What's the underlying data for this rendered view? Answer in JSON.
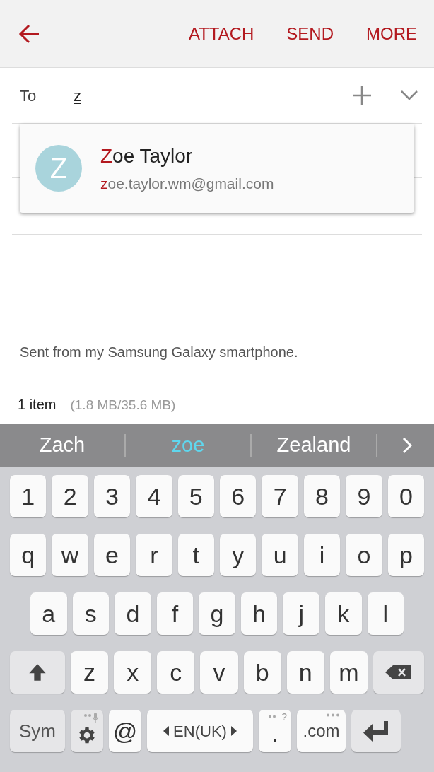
{
  "toolbar": {
    "actions": [
      "ATTACH",
      "SEND",
      "MORE"
    ]
  },
  "to_field": {
    "label": "To",
    "value": "z"
  },
  "suggestion_popup": {
    "avatar_letter": "Z",
    "name_match": "Z",
    "name_rest": "oe Taylor",
    "email_match": "z",
    "email_rest": "oe.taylor.wm@gmail.com"
  },
  "body": {
    "signature": "Sent from my Samsung Galaxy smartphone."
  },
  "attachments": {
    "count": "1 item",
    "size": "(1.8 MB/35.6 MB)"
  },
  "word_suggestions": [
    {
      "label": "Zach",
      "selected": false
    },
    {
      "label": "zoe",
      "selected": true
    },
    {
      "label": "Zealand",
      "selected": false
    }
  ],
  "keyboard": {
    "rows": [
      [
        {
          "kind": "char",
          "label": "1"
        },
        {
          "kind": "char",
          "label": "2"
        },
        {
          "kind": "char",
          "label": "3"
        },
        {
          "kind": "char",
          "label": "4"
        },
        {
          "kind": "char",
          "label": "5"
        },
        {
          "kind": "char",
          "label": "6"
        },
        {
          "kind": "char",
          "label": "7"
        },
        {
          "kind": "char",
          "label": "8"
        },
        {
          "kind": "char",
          "label": "9"
        },
        {
          "kind": "char",
          "label": "0"
        }
      ],
      [
        {
          "kind": "char",
          "label": "q"
        },
        {
          "kind": "char",
          "label": "w"
        },
        {
          "kind": "char",
          "label": "e"
        },
        {
          "kind": "char",
          "label": "r"
        },
        {
          "kind": "char",
          "label": "t"
        },
        {
          "kind": "char",
          "label": "y"
        },
        {
          "kind": "char",
          "label": "u"
        },
        {
          "kind": "char",
          "label": "i"
        },
        {
          "kind": "char",
          "label": "o"
        },
        {
          "kind": "char",
          "label": "p"
        }
      ],
      [
        {
          "kind": "char",
          "label": "a"
        },
        {
          "kind": "char",
          "label": "s"
        },
        {
          "kind": "char",
          "label": "d"
        },
        {
          "kind": "char",
          "label": "f"
        },
        {
          "kind": "char",
          "label": "g"
        },
        {
          "kind": "char",
          "label": "h"
        },
        {
          "kind": "char",
          "label": "j"
        },
        {
          "kind": "char",
          "label": "k"
        },
        {
          "kind": "char",
          "label": "l"
        }
      ],
      [
        {
          "kind": "shift"
        },
        {
          "kind": "char",
          "label": "z"
        },
        {
          "kind": "char",
          "label": "x"
        },
        {
          "kind": "char",
          "label": "c"
        },
        {
          "kind": "char",
          "label": "v"
        },
        {
          "kind": "char",
          "label": "b"
        },
        {
          "kind": "char",
          "label": "n"
        },
        {
          "kind": "char",
          "label": "m"
        },
        {
          "kind": "backspace"
        }
      ],
      [
        {
          "kind": "sym",
          "label": "Sym"
        },
        {
          "kind": "settings"
        },
        {
          "kind": "at",
          "label": "@"
        },
        {
          "kind": "space",
          "label": "EN(UK)"
        },
        {
          "kind": "period",
          "label": ".",
          "hint": "?"
        },
        {
          "kind": "dotcom",
          "label": ".com"
        },
        {
          "kind": "enter"
        }
      ]
    ]
  }
}
